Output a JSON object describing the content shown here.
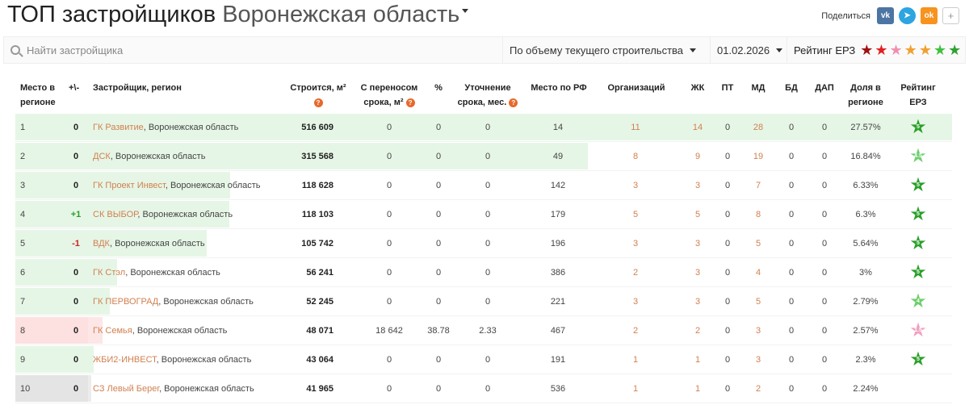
{
  "header": {
    "title": "ТОП застройщиков",
    "region": "Воронежская область",
    "share_label": "Поделиться",
    "share_icons": [
      "vk-icon",
      "telegram-icon",
      "odnoklassniki-icon",
      "plus-icon"
    ]
  },
  "toolbar": {
    "search_placeholder": "Найти застройщика",
    "sort_value": "По объему текущего строительства",
    "date_value": "01.02.2026",
    "rating_label": "Рейтинг ЕРЗ",
    "rating_stars": [
      "#a01010",
      "#e02020",
      "#f090b0",
      "#f0a030",
      "#f0a030",
      "#40c040",
      "#30a030"
    ]
  },
  "columns": {
    "place": "Место в регионе",
    "delta": "+\\-",
    "developer": "Застройщик, регион",
    "building": "Строится, м²",
    "postponed": "С переносом срока, м²",
    "percent": "%",
    "clarification": "Уточнение срока, мес.",
    "rf_place": "Место по РФ",
    "orgs": "Организаций",
    "zhk": "ЖК",
    "pt": "ПТ",
    "md": "МД",
    "bd": "БД",
    "dap": "ДАП",
    "share": "Доля в регионе",
    "rating": "Рейтинг ЕРЗ"
  },
  "rows": [
    {
      "place": "1",
      "delta": "0",
      "name": "ГК Развитие",
      "region": ", Воронежская область",
      "building": "516 609",
      "postponed": "0",
      "percent": "0",
      "clar": "0",
      "rf": "14",
      "orgs": "11",
      "zhk": "14",
      "pt": "0",
      "md": "28",
      "bd": "0",
      "dap": "0",
      "share": "27.57%",
      "rating": "5",
      "share_fraction": 0.2757,
      "bar_color": "#e6f6e6",
      "place_color": "",
      "star_color": "#2aa02a"
    },
    {
      "place": "2",
      "delta": "0",
      "name": "ДСК",
      "region": ", Воронежская область",
      "building": "315 568",
      "postponed": "0",
      "percent": "0",
      "clar": "0",
      "rf": "49",
      "orgs": "8",
      "zhk": "9",
      "pt": "0",
      "md": "19",
      "bd": "0",
      "dap": "0",
      "share": "16.84%",
      "rating": "4.5",
      "share_fraction": 0.1684,
      "bar_color": "#e6f6e6",
      "place_color": "",
      "star_color": "#6fce6f"
    },
    {
      "place": "3",
      "delta": "0",
      "name": "ГК Проект Инвест",
      "region": ", Воронежская область",
      "building": "118 628",
      "postponed": "0",
      "percent": "0",
      "clar": "0",
      "rf": "142",
      "orgs": "3",
      "zhk": "3",
      "pt": "0",
      "md": "7",
      "bd": "0",
      "dap": "0",
      "share": "6.33%",
      "rating": "5",
      "share_fraction": 0.0633,
      "bar_color": "#e6f6e6",
      "place_color": "",
      "star_color": "#2aa02a"
    },
    {
      "place": "4",
      "delta": "+1",
      "name": "СК ВЫБОР",
      "region": ", Воронежская область",
      "building": "118 103",
      "postponed": "0",
      "percent": "0",
      "clar": "0",
      "rf": "179",
      "orgs": "5",
      "zhk": "5",
      "pt": "0",
      "md": "8",
      "bd": "0",
      "dap": "0",
      "share": "6.3%",
      "rating": "5",
      "share_fraction": 0.063,
      "bar_color": "#e6f6e6",
      "place_color": "",
      "star_color": "#2aa02a"
    },
    {
      "place": "5",
      "delta": "-1",
      "name": "ВДК",
      "region": ", Воронежская область",
      "building": "105 742",
      "postponed": "0",
      "percent": "0",
      "clar": "0",
      "rf": "196",
      "orgs": "3",
      "zhk": "3",
      "pt": "0",
      "md": "5",
      "bd": "0",
      "dap": "0",
      "share": "5.64%",
      "rating": "5",
      "share_fraction": 0.0564,
      "bar_color": "#e6f6e6",
      "place_color": "",
      "star_color": "#2aa02a"
    },
    {
      "place": "6",
      "delta": "0",
      "name": "ГК Стэл",
      "region": ", Воронежская область",
      "building": "56 241",
      "postponed": "0",
      "percent": "0",
      "clar": "0",
      "rf": "386",
      "orgs": "2",
      "zhk": "3",
      "pt": "0",
      "md": "4",
      "bd": "0",
      "dap": "0",
      "share": "3%",
      "rating": "5",
      "share_fraction": 0.03,
      "bar_color": "#e6f6e6",
      "place_color": "",
      "star_color": "#2aa02a"
    },
    {
      "place": "7",
      "delta": "0",
      "name": "ГК ПЕРВОГРАД",
      "region": ", Воронежская область",
      "building": "52 245",
      "postponed": "0",
      "percent": "0",
      "clar": "0",
      "rf": "221",
      "orgs": "3",
      "zhk": "3",
      "pt": "0",
      "md": "5",
      "bd": "0",
      "dap": "0",
      "share": "2.79%",
      "rating": "4",
      "share_fraction": 0.0279,
      "bar_color": "#e6f6e6",
      "place_color": "",
      "star_color": "#6fce6f"
    },
    {
      "place": "8",
      "delta": "0",
      "name": "ГК Семья",
      "region": ", Воронежская область",
      "building": "48 071",
      "postponed": "18 642",
      "percent": "38.78",
      "clar": "2.33",
      "rf": "467",
      "orgs": "2",
      "zhk": "2",
      "pt": "0",
      "md": "3",
      "bd": "0",
      "dap": "0",
      "share": "2.57%",
      "rating": "1.5",
      "share_fraction": 0.0257,
      "bar_color": "#fde6e6",
      "place_color": "#fde0e0",
      "star_color": "#f0a0c0"
    },
    {
      "place": "9",
      "delta": "0",
      "name": "ЖБИ2-ИНВЕСТ",
      "region": ", Воронежская область",
      "building": "43 064",
      "postponed": "0",
      "percent": "0",
      "clar": "0",
      "rf": "191",
      "orgs": "1",
      "zhk": "1",
      "pt": "0",
      "md": "3",
      "bd": "0",
      "dap": "0",
      "share": "2.3%",
      "rating": "5",
      "share_fraction": 0.023,
      "bar_color": "#e6f6e6",
      "place_color": "",
      "star_color": "#2aa02a"
    },
    {
      "place": "10",
      "delta": "0",
      "name": "СЗ Левый Берег",
      "region": ", Воронежская область",
      "building": "41 965",
      "postponed": "0",
      "percent": "0",
      "clar": "0",
      "rf": "536",
      "orgs": "1",
      "zhk": "1",
      "pt": "0",
      "md": "2",
      "bd": "0",
      "dap": "0",
      "share": "2.24%",
      "rating": "",
      "share_fraction": 0.0224,
      "bar_color": "#ececec",
      "place_color": "#e4e4e4",
      "star_color": ""
    }
  ]
}
